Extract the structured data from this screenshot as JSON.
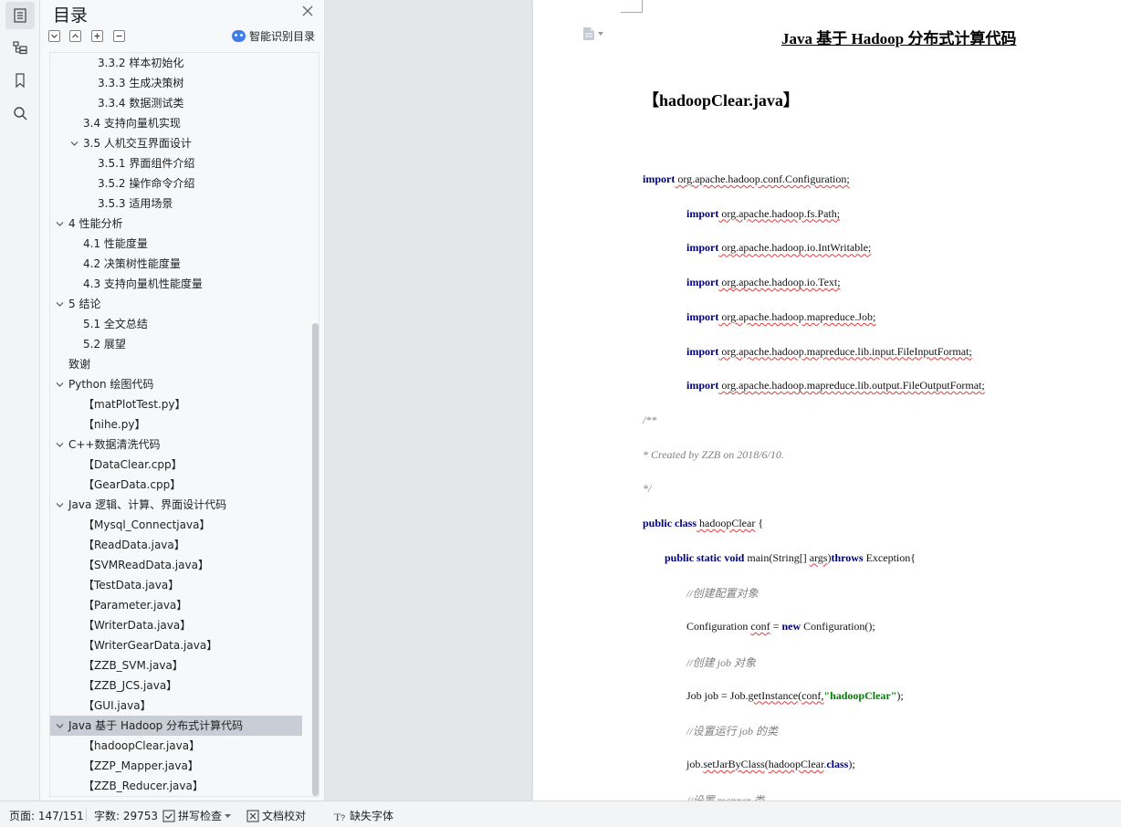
{
  "toc": {
    "title": "目录",
    "smart_label": "智能识别目录",
    "items": [
      {
        "label": "3.3.2  样本初始化",
        "level": 3,
        "expanded": null
      },
      {
        "label": "3.3.3  生成决策树",
        "level": 3,
        "expanded": null
      },
      {
        "label": "3.3.4  数据测试类",
        "level": 3,
        "expanded": null
      },
      {
        "label": "3.4  支持向量机实现",
        "level": 2,
        "expanded": null
      },
      {
        "label": "3.5  人机交互界面设计",
        "level": 2,
        "expanded": true
      },
      {
        "label": "3.5.1  界面组件介绍",
        "level": 3,
        "expanded": null
      },
      {
        "label": "3.5.2  操作命令介绍",
        "level": 3,
        "expanded": null
      },
      {
        "label": "3.5.3  适用场景",
        "level": 3,
        "expanded": null
      },
      {
        "label": "4  性能分析",
        "level": 1,
        "expanded": true
      },
      {
        "label": "4.1  性能度量",
        "level": 2,
        "expanded": null
      },
      {
        "label": "4.2  决策树性能度量",
        "level": 2,
        "expanded": null
      },
      {
        "label": "4.3  支持向量机性能度量",
        "level": 2,
        "expanded": null
      },
      {
        "label": "5  结论",
        "level": 1,
        "expanded": true
      },
      {
        "label": "5.1  全文总结",
        "level": 2,
        "expanded": null
      },
      {
        "label": "5.2  展望",
        "level": 2,
        "expanded": null
      },
      {
        "label": "致谢",
        "level": 1,
        "expanded": null
      },
      {
        "label": "Python 绘图代码",
        "level": 1,
        "expanded": true
      },
      {
        "label": "【matPlotTest.py】",
        "level": 2,
        "expanded": null
      },
      {
        "label": "【nihe.py】",
        "level": 2,
        "expanded": null
      },
      {
        "label": "C++数据清洗代码",
        "level": 1,
        "expanded": true
      },
      {
        "label": "【DataClear.cpp】",
        "level": 2,
        "expanded": null
      },
      {
        "label": "【GearData.cpp】",
        "level": 2,
        "expanded": null
      },
      {
        "label": "Java  逻辑、计算、界面设计代码",
        "level": 1,
        "expanded": true
      },
      {
        "label": "【Mysql_Connectjava】",
        "level": 2,
        "expanded": null
      },
      {
        "label": "【ReadData.java】",
        "level": 2,
        "expanded": null
      },
      {
        "label": "【SVMReadData.java】",
        "level": 2,
        "expanded": null
      },
      {
        "label": "【TestData.java】",
        "level": 2,
        "expanded": null
      },
      {
        "label": "【Parameter.java】",
        "level": 2,
        "expanded": null
      },
      {
        "label": "【WriterData.java】",
        "level": 2,
        "expanded": null
      },
      {
        "label": "【WriterGearData.java】",
        "level": 2,
        "expanded": null
      },
      {
        "label": "【ZZB_SVM.java】",
        "level": 2,
        "expanded": null
      },
      {
        "label": "【ZZB_JCS.java】",
        "level": 2,
        "expanded": null
      },
      {
        "label": "【GUI.java】",
        "level": 2,
        "expanded": null
      },
      {
        "label": "Java  基于 Hadoop 分布式计算代码",
        "level": 1,
        "expanded": true,
        "selected": true
      },
      {
        "label": "【hadoopClear.java】",
        "level": 2,
        "expanded": null
      },
      {
        "label": "【ZZP_Mapper.java】",
        "level": 2,
        "expanded": null
      },
      {
        "label": "【ZZB_Reducer.java】",
        "level": 2,
        "expanded": null
      }
    ]
  },
  "document": {
    "title": "Java  基于 Hadoop 分布式计算代码",
    "subtitle": "【hadoopClear.java】",
    "lines": [
      {
        "indent": 0,
        "parts": [
          {
            "t": "import",
            "c": "kw"
          },
          {
            "t": " org.apache.hadoop.conf.Configuration;",
            "c": "sq"
          }
        ]
      },
      {
        "indent": 1,
        "parts": [
          {
            "t": "import",
            "c": "kw"
          },
          {
            "t": " org.apache.hadoop.fs.Path;",
            "c": "sq"
          }
        ]
      },
      {
        "indent": 1,
        "parts": [
          {
            "t": "import",
            "c": "kw"
          },
          {
            "t": " org.apache.hadoop.io.IntWritable;",
            "c": "sq"
          }
        ]
      },
      {
        "indent": 1,
        "parts": [
          {
            "t": "import",
            "c": "kw"
          },
          {
            "t": " org.apache.hadoop.io.Text;",
            "c": "sq"
          }
        ]
      },
      {
        "indent": 1,
        "parts": [
          {
            "t": "import",
            "c": "kw"
          },
          {
            "t": " org.apache.hadoop.mapreduce.Job;",
            "c": "sq"
          }
        ]
      },
      {
        "indent": 1,
        "parts": [
          {
            "t": "import",
            "c": "kw"
          },
          {
            "t": " org.apache.hadoop.mapreduce.lib.input.FileInputFormat;",
            "c": "sq"
          }
        ]
      },
      {
        "indent": 1,
        "parts": [
          {
            "t": "import",
            "c": "kw"
          },
          {
            "t": " org.apache.hadoop.mapreduce.lib.output.FileOutputFormat;",
            "c": "sq"
          }
        ]
      },
      {
        "indent": 0,
        "parts": [
          {
            "t": "/**",
            "c": "cmt"
          }
        ]
      },
      {
        "indent": 0,
        "parts": [
          {
            "t": "  * Created by    ZZB on 2018/6/10.",
            "c": "cmt"
          }
        ]
      },
      {
        "indent": 0,
        "parts": [
          {
            "t": "   */",
            "c": "cmt"
          }
        ]
      },
      {
        "indent": 0,
        "parts": [
          {
            "t": "public class",
            "c": "kw"
          },
          {
            "t": " hadoopClear",
            "c": "sq"
          },
          {
            "t": " {",
            "c": ""
          }
        ]
      },
      {
        "indent": 0.5,
        "parts": [
          {
            "t": "public static void",
            "c": "kw"
          },
          {
            "t": " main(String[] ",
            "c": ""
          },
          {
            "t": "args",
            "c": "sq"
          },
          {
            "t": ")",
            "c": ""
          },
          {
            "t": "throws",
            "c": "kw"
          },
          {
            "t": " Exception{",
            "c": ""
          }
        ]
      },
      {
        "indent": 1,
        "parts": [
          {
            "t": "//创建配置对象",
            "c": "cmt"
          }
        ]
      },
      {
        "indent": 1,
        "parts": [
          {
            "t": "Configuration ",
            "c": ""
          },
          {
            "t": "conf",
            "c": "sq"
          },
          {
            "t": " = ",
            "c": ""
          },
          {
            "t": "new",
            "c": "kw"
          },
          {
            "t": " Configuration();",
            "c": ""
          }
        ]
      },
      {
        "indent": 1,
        "parts": [
          {
            "t": "//创建 job 对象",
            "c": "cmt"
          }
        ]
      },
      {
        "indent": 1,
        "parts": [
          {
            "t": "Job job = Job.",
            "c": ""
          },
          {
            "t": "getInstance",
            "c": "sq"
          },
          {
            "t": "(",
            "c": ""
          },
          {
            "t": "conf,",
            "c": "sq"
          },
          {
            "t": "\"hadoopClear\"",
            "c": "str"
          },
          {
            "t": ");",
            "c": ""
          }
        ]
      },
      {
        "indent": 1,
        "parts": [
          {
            "t": "//设置运行 job 的类",
            "c": "cmt"
          }
        ]
      },
      {
        "indent": 1,
        "parts": [
          {
            "t": "job.",
            "c": ""
          },
          {
            "t": "setJarByClass",
            "c": "sq"
          },
          {
            "t": "(",
            "c": ""
          },
          {
            "t": "hadoopClear",
            "c": "sq"
          },
          {
            "t": ".",
            "c": ""
          },
          {
            "t": "class",
            "c": "kw"
          },
          {
            "t": ");",
            "c": ""
          }
        ]
      },
      {
        "indent": 1,
        "parts": [
          {
            "t": "//设置 mapper  类",
            "c": "cmt"
          }
        ]
      }
    ]
  },
  "status": {
    "page": "页面: 147/151",
    "words": "字数: 29753",
    "spell": "拼写检查",
    "proof": "文档校对",
    "font": "缺失字体"
  },
  "colors": {
    "keyword": "#000080",
    "comment": "#808080",
    "string": "#008000",
    "selected_row": "#c9ced6",
    "accent": "#3f7ee8"
  }
}
